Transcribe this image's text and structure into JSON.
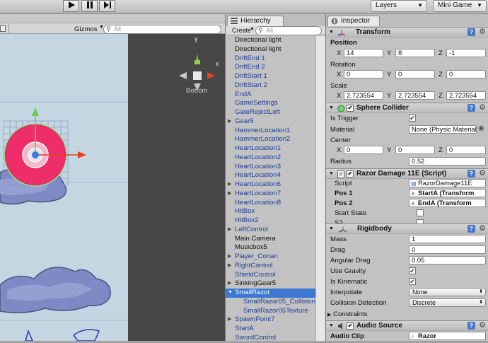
{
  "toolbar": {
    "play_icon": "play-icon",
    "pause_icon": "pause-icon",
    "step_icon": "step-icon",
    "layers_label": "Layers",
    "layout_label": "Mini Game"
  },
  "scene": {
    "gizmos_label": "Gizmos",
    "search_placeholder": "All",
    "overlay_label": "Bottom",
    "gizmo_axis_y": "y",
    "gizmo_axis_x": "x"
  },
  "hierarchy": {
    "tab_label": "Hierarchy",
    "create_label": "Create",
    "search_placeholder": "All",
    "items": [
      {
        "label": "Directional light",
        "kind": "plain",
        "fold": false,
        "selected": false,
        "child": false
      },
      {
        "label": "Directional light",
        "kind": "plain",
        "fold": false,
        "selected": false,
        "child": false
      },
      {
        "label": "DriftEnd 1",
        "kind": "prefab",
        "fold": false,
        "selected": false,
        "child": false
      },
      {
        "label": "DriftEnd 2",
        "kind": "prefab",
        "fold": false,
        "selected": false,
        "child": false
      },
      {
        "label": "DriftStart 1",
        "kind": "prefab",
        "fold": false,
        "selected": false,
        "child": false
      },
      {
        "label": "DriftStart 2",
        "kind": "prefab",
        "fold": false,
        "selected": false,
        "child": false
      },
      {
        "label": "EndA",
        "kind": "prefab",
        "fold": false,
        "selected": false,
        "child": false
      },
      {
        "label": "GameSettings",
        "kind": "prefab",
        "fold": false,
        "selected": false,
        "child": false
      },
      {
        "label": "GateRejectLeft",
        "kind": "prefab",
        "fold": false,
        "selected": false,
        "child": false
      },
      {
        "label": "Gear5",
        "kind": "prefab",
        "fold": true,
        "selected": false,
        "child": false
      },
      {
        "label": "HammerLocation1",
        "kind": "prefab",
        "fold": false,
        "selected": false,
        "child": false
      },
      {
        "label": "HammerLocation2",
        "kind": "prefab",
        "fold": false,
        "selected": false,
        "child": false
      },
      {
        "label": "HeartLocation1",
        "kind": "prefab",
        "fold": false,
        "selected": false,
        "child": false
      },
      {
        "label": "HeartLocation2",
        "kind": "prefab",
        "fold": false,
        "selected": false,
        "child": false
      },
      {
        "label": "HeartLocation3",
        "kind": "prefab",
        "fold": false,
        "selected": false,
        "child": false
      },
      {
        "label": "HeartLocation4",
        "kind": "prefab",
        "fold": false,
        "selected": false,
        "child": false
      },
      {
        "label": "HeartLocation6",
        "kind": "prefab",
        "fold": true,
        "selected": false,
        "child": false
      },
      {
        "label": "HeartLocation7",
        "kind": "prefab",
        "fold": true,
        "selected": false,
        "child": false
      },
      {
        "label": "HeartLocation8",
        "kind": "prefab",
        "fold": false,
        "selected": false,
        "child": false
      },
      {
        "label": "HitBox",
        "kind": "prefab",
        "fold": false,
        "selected": false,
        "child": false
      },
      {
        "label": "HitBox2",
        "kind": "prefab",
        "fold": false,
        "selected": false,
        "child": false
      },
      {
        "label": "LeftControl",
        "kind": "prefab",
        "fold": true,
        "selected": false,
        "child": false
      },
      {
        "label": "Main Camera",
        "kind": "plain",
        "fold": false,
        "selected": false,
        "child": false
      },
      {
        "label": "Musicbox5",
        "kind": "plain",
        "fold": false,
        "selected": false,
        "child": false
      },
      {
        "label": "Player_Conan",
        "kind": "prefab",
        "fold": true,
        "selected": false,
        "child": false
      },
      {
        "label": "RightControl",
        "kind": "prefab",
        "fold": true,
        "selected": false,
        "child": false
      },
      {
        "label": "ShieldControl",
        "kind": "prefab",
        "fold": false,
        "selected": false,
        "child": false
      },
      {
        "label": "SinkingGear5",
        "kind": "plain",
        "fold": true,
        "selected": false,
        "child": false
      },
      {
        "label": "SmallRazor",
        "kind": "prefab",
        "fold": true,
        "selected": true,
        "child": false
      },
      {
        "label": "SmallRazor05_Collision",
        "kind": "prefab",
        "fold": false,
        "selected": false,
        "child": true
      },
      {
        "label": "SmallRazor05Texture",
        "kind": "prefab",
        "fold": false,
        "selected": false,
        "child": true
      },
      {
        "label": "SpawnPoint7",
        "kind": "prefab",
        "fold": true,
        "selected": false,
        "child": false
      },
      {
        "label": "StartA",
        "kind": "prefab",
        "fold": false,
        "selected": false,
        "child": false
      },
      {
        "label": "SwordControl",
        "kind": "prefab",
        "fold": false,
        "selected": false,
        "child": false
      }
    ]
  },
  "inspector": {
    "tab_label": "Inspector",
    "transform": {
      "title": "Transform",
      "position_label": "Position",
      "rotation_label": "Rotation",
      "scale_label": "Scale",
      "position": {
        "x": "14",
        "y": "8",
        "z": "-1"
      },
      "rotation": {
        "x": "0",
        "y": "0",
        "z": "0"
      },
      "scale": {
        "x": "2.723554",
        "y": "2.723554",
        "z": "2.723554"
      },
      "x_label": "X",
      "y_label": "Y",
      "z_label": "Z"
    },
    "sphere_collider": {
      "title": "Sphere Collider",
      "is_trigger_label": "Is Trigger",
      "material_label": "Material",
      "material_value": "None (Physic Material",
      "center_label": "Center",
      "center": {
        "x": "0",
        "y": "0",
        "z": "0"
      },
      "radius_label": "Radius",
      "radius_value": "0.52"
    },
    "razor_script": {
      "title": "Razor Damage 11E (Script)",
      "script_label": "Script",
      "script_value": "RazorDamage11E",
      "pos1_label": "Pos 1",
      "pos1_value": "StartA (Transform",
      "pos2_label": "Pos 2",
      "pos2_value": "EndA (Transform",
      "start_state_label": "Start State",
      "s2_label": "S2"
    },
    "rigidbody": {
      "title": "Rigidbody",
      "mass_label": "Mass",
      "mass_value": "1",
      "drag_label": "Drag",
      "drag_value": "0",
      "angular_drag_label": "Angular Drag",
      "angular_drag_value": "0.05",
      "use_gravity_label": "Use Gravity",
      "is_kinematic_label": "Is Kinematic",
      "interpolate_label": "Interpolate",
      "interpolate_value": "None",
      "collision_detection_label": "Collision Detection",
      "collision_detection_value": "Discrete",
      "constraints_label": "Constraints"
    },
    "audio_source": {
      "title": "Audio Source",
      "audio_clip_label": "Audio Clip",
      "audio_clip_value": "Razor"
    }
  }
}
